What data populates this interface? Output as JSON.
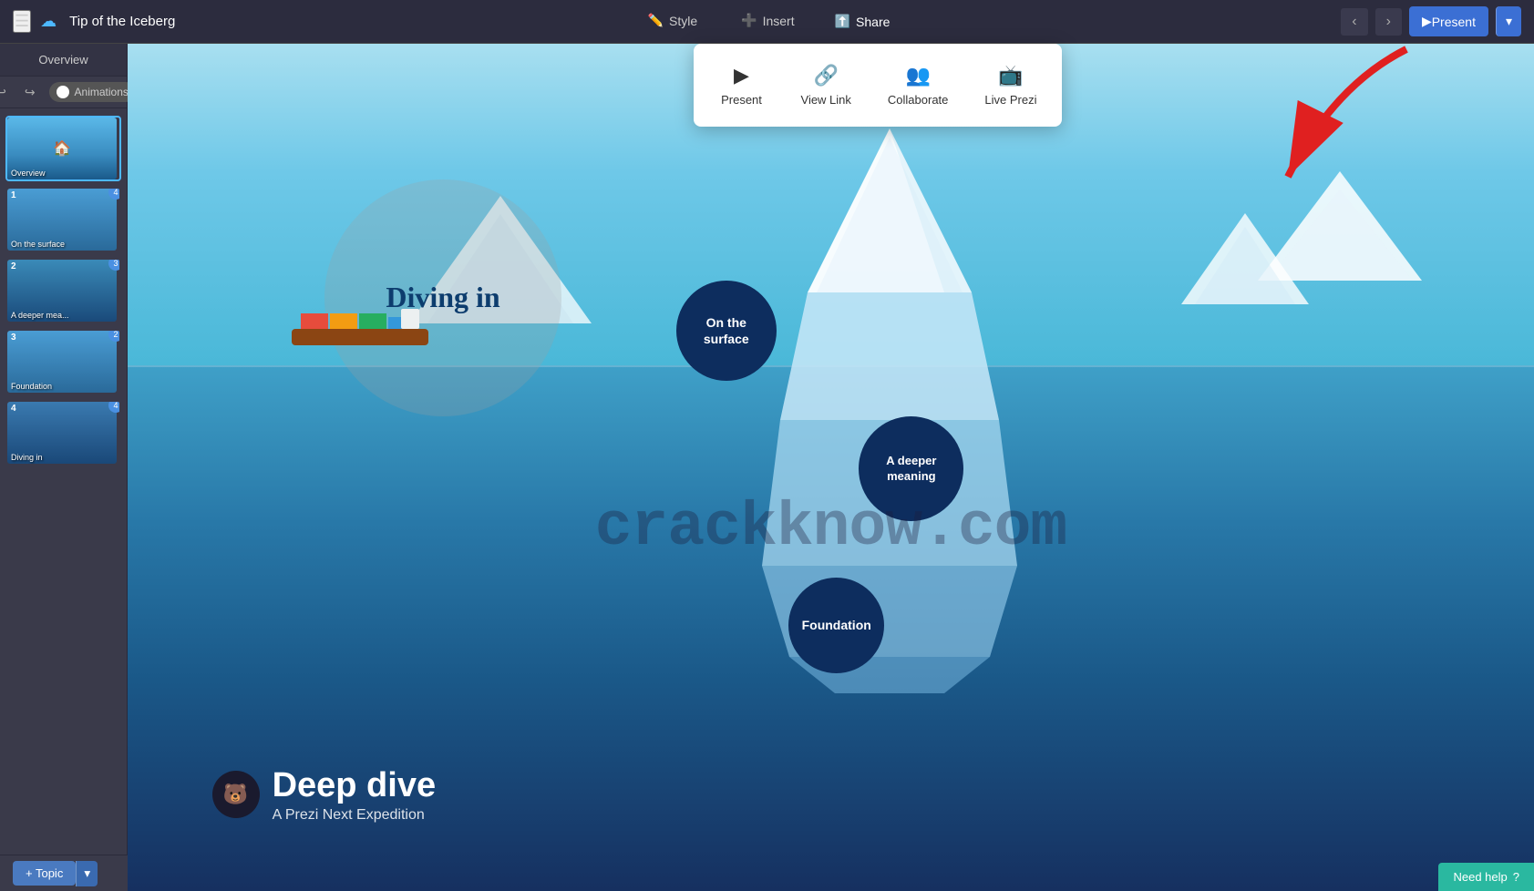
{
  "topbar": {
    "title": "Tip of the Iceberg",
    "tabs": [
      {
        "id": "style",
        "label": "Style",
        "icon": "✏️"
      },
      {
        "id": "insert",
        "label": "Insert",
        "icon": "➕"
      },
      {
        "id": "share",
        "label": "Share",
        "icon": "⬆️"
      }
    ],
    "present_label": "Present",
    "animations_label": "Animations"
  },
  "share_dropdown": {
    "items": [
      {
        "id": "present",
        "label": "Present",
        "icon": "▶"
      },
      {
        "id": "view_link",
        "label": "View Link",
        "icon": "🔗"
      },
      {
        "id": "collaborate",
        "label": "Collaborate",
        "icon": "👥"
      },
      {
        "id": "live_prezi",
        "label": "Live Prezi",
        "icon": "📺"
      }
    ]
  },
  "sidebar": {
    "header": "Overview",
    "slides": [
      {
        "number": "",
        "label": "Overview",
        "badge": "",
        "type": "overview"
      },
      {
        "number": "1",
        "label": "On the surface",
        "badge": "4",
        "type": "1"
      },
      {
        "number": "2",
        "label": "A deeper mea...",
        "badge": "3",
        "type": "2"
      },
      {
        "number": "3",
        "label": "Foundation",
        "badge": "2",
        "type": "3"
      },
      {
        "number": "4",
        "label": "Diving in",
        "badge": "4",
        "type": "4"
      }
    ]
  },
  "canvas": {
    "diving_in": "Diving in",
    "on_the_surface": "On the\nsurface",
    "a_deeper_meaning": "A deeper\nmeaning",
    "foundation": "Foundation",
    "watermark": "crackknow.com",
    "deep_dive_title": "Deep dive",
    "deep_dive_sub": "A Prezi Next Expedition"
  },
  "bottom": {
    "add_topic": "+ Topic",
    "need_help": "Need help"
  }
}
